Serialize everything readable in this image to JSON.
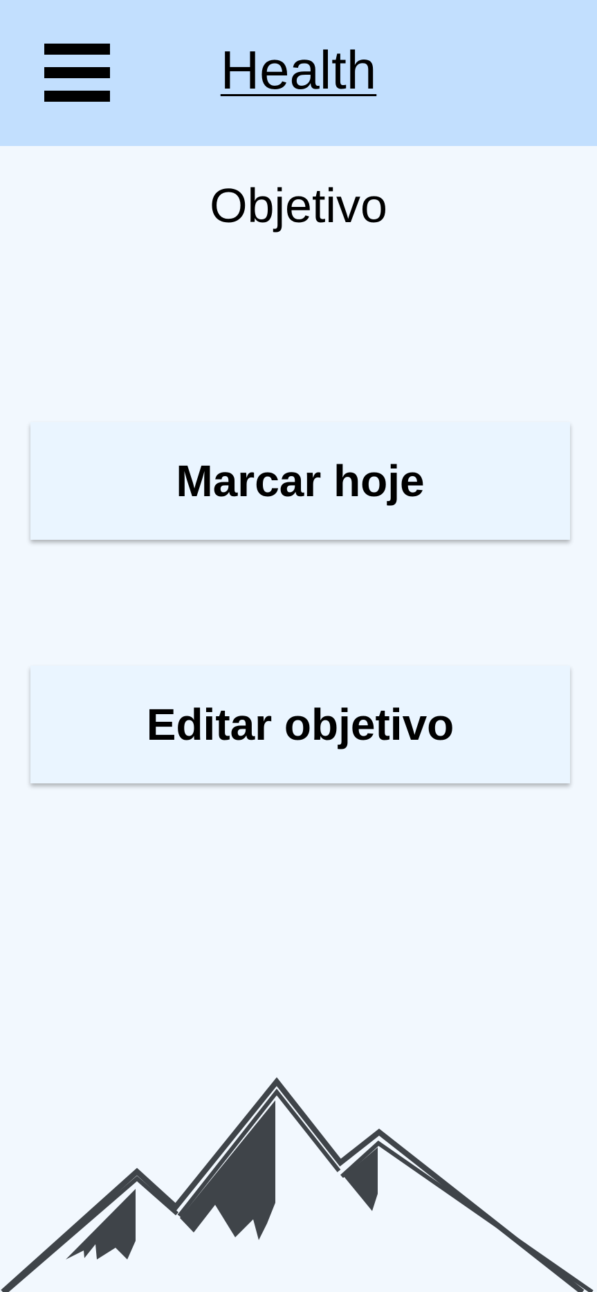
{
  "header": {
    "menu_icon": "hamburger-menu-icon",
    "app_title": "Health",
    "background_color": "#c2dffe"
  },
  "main": {
    "page_title": "Objetivo",
    "buttons": [
      {
        "label": "Marcar hoje"
      },
      {
        "label": "Editar objetivo"
      }
    ],
    "illustration_icon": "mountain-icon",
    "background_color": "#f2f8fe"
  }
}
